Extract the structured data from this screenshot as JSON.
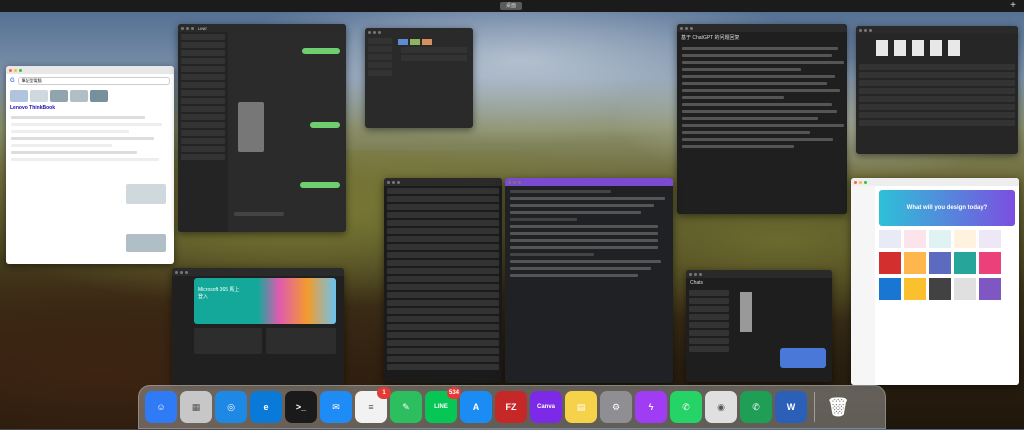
{
  "menubar": {
    "desktop_label": "桌面",
    "plus_label": "+"
  },
  "windows": {
    "browser_search": {
      "query": "筆記型電腦",
      "section_title": "Lenovo ThinkBook"
    },
    "chat": {
      "title": "LINE"
    },
    "doc": {
      "title": "基于 ChatGPT 的问题回复"
    },
    "canva": {
      "heading": "What will you design today?"
    },
    "store": {
      "title": "Microsoft 365 馬上登入"
    },
    "messenger": {
      "title": "Chats"
    }
  },
  "dock": {
    "apps": [
      {
        "name": "Finder",
        "color": "#2f7bf5",
        "glyph": "☺"
      },
      {
        "name": "Launchpad",
        "color": "#c7c7c7",
        "glyph": "▦"
      },
      {
        "name": "Safari",
        "color": "#1e88e5",
        "glyph": "◎"
      },
      {
        "name": "Edge",
        "color": "#0a7ad8",
        "glyph": "e"
      },
      {
        "name": "Terminal",
        "color": "#1a1a1a",
        "glyph": ">_"
      },
      {
        "name": "Mail",
        "color": "#1f8cf5",
        "glyph": "✉"
      },
      {
        "name": "Reminders",
        "color": "#f2f2f2",
        "glyph": "≡",
        "badge": "1"
      },
      {
        "name": "Evernote",
        "color": "#2dbe60",
        "glyph": "✎"
      },
      {
        "name": "LINE",
        "color": "#06c755",
        "glyph": "LINE",
        "badge": "534"
      },
      {
        "name": "App Store",
        "color": "#1c8cf5",
        "glyph": "A"
      },
      {
        "name": "FileZilla",
        "color": "#c62828",
        "glyph": "FZ"
      },
      {
        "name": "Canva",
        "color": "#7d2ae8",
        "glyph": "Canva"
      },
      {
        "name": "Notes",
        "color": "#f6d24a",
        "glyph": "▤"
      },
      {
        "name": "System Settings",
        "color": "#8e8e93",
        "glyph": "⚙"
      },
      {
        "name": "Messenger",
        "color": "#a13cf5",
        "glyph": "ϟ"
      },
      {
        "name": "WhatsApp",
        "color": "#25d366",
        "glyph": "✆"
      },
      {
        "name": "Chrome",
        "color": "#e0e0e0",
        "glyph": "◉"
      },
      {
        "name": "WhatsApp Business",
        "color": "#1f9e55",
        "glyph": "✆"
      },
      {
        "name": "Word",
        "color": "#2b5fb8",
        "glyph": "W"
      }
    ],
    "trash": {
      "name": "Trash",
      "glyph": "🗑"
    }
  }
}
